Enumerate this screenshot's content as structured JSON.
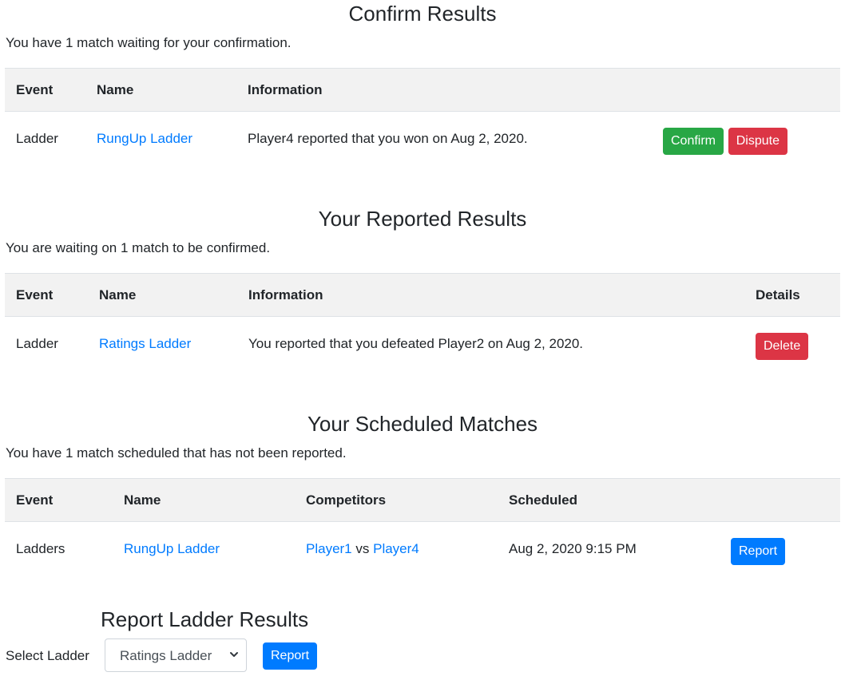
{
  "confirm": {
    "title": "Confirm Results",
    "subtitle": "You have 1 match waiting for your confirmation.",
    "headers": {
      "event": "Event",
      "name": "Name",
      "information": "Information"
    },
    "row": {
      "event": "Ladder",
      "name": "RungUp Ladder",
      "information": "Player4 reported that you won on Aug 2, 2020.",
      "confirm_label": "Confirm",
      "dispute_label": "Dispute"
    }
  },
  "reported": {
    "title": "Your Reported Results",
    "subtitle": "You are waiting on 1 match to be confirmed.",
    "headers": {
      "event": "Event",
      "name": "Name",
      "information": "Information",
      "details": "Details"
    },
    "row": {
      "event": "Ladder",
      "name": "Ratings Ladder",
      "information": "You reported that you defeated Player2 on Aug 2, 2020.",
      "delete_label": "Delete"
    }
  },
  "scheduled": {
    "title": "Your Scheduled Matches",
    "subtitle": "You have 1 match scheduled that has not been reported.",
    "headers": {
      "event": "Event",
      "name": "Name",
      "competitors": "Competitors",
      "scheduled": "Scheduled"
    },
    "row": {
      "event": "Ladders",
      "name": "RungUp Ladder",
      "player_a": "Player1",
      "vs": "vs",
      "player_b": "Player4",
      "scheduled": "Aug 2, 2020 9:15 PM",
      "report_label": "Report"
    }
  },
  "report_ladder": {
    "title": "Report Ladder Results",
    "select_label": "Select Ladder",
    "selected": "Ratings Ladder",
    "report_label": "Report",
    "chevron_icon": "chevron-down-icon"
  },
  "colors": {
    "link": "#007bff",
    "success": "#28a745",
    "danger": "#dc3545",
    "primary": "#007bff",
    "header_bg": "#f2f2f2"
  }
}
